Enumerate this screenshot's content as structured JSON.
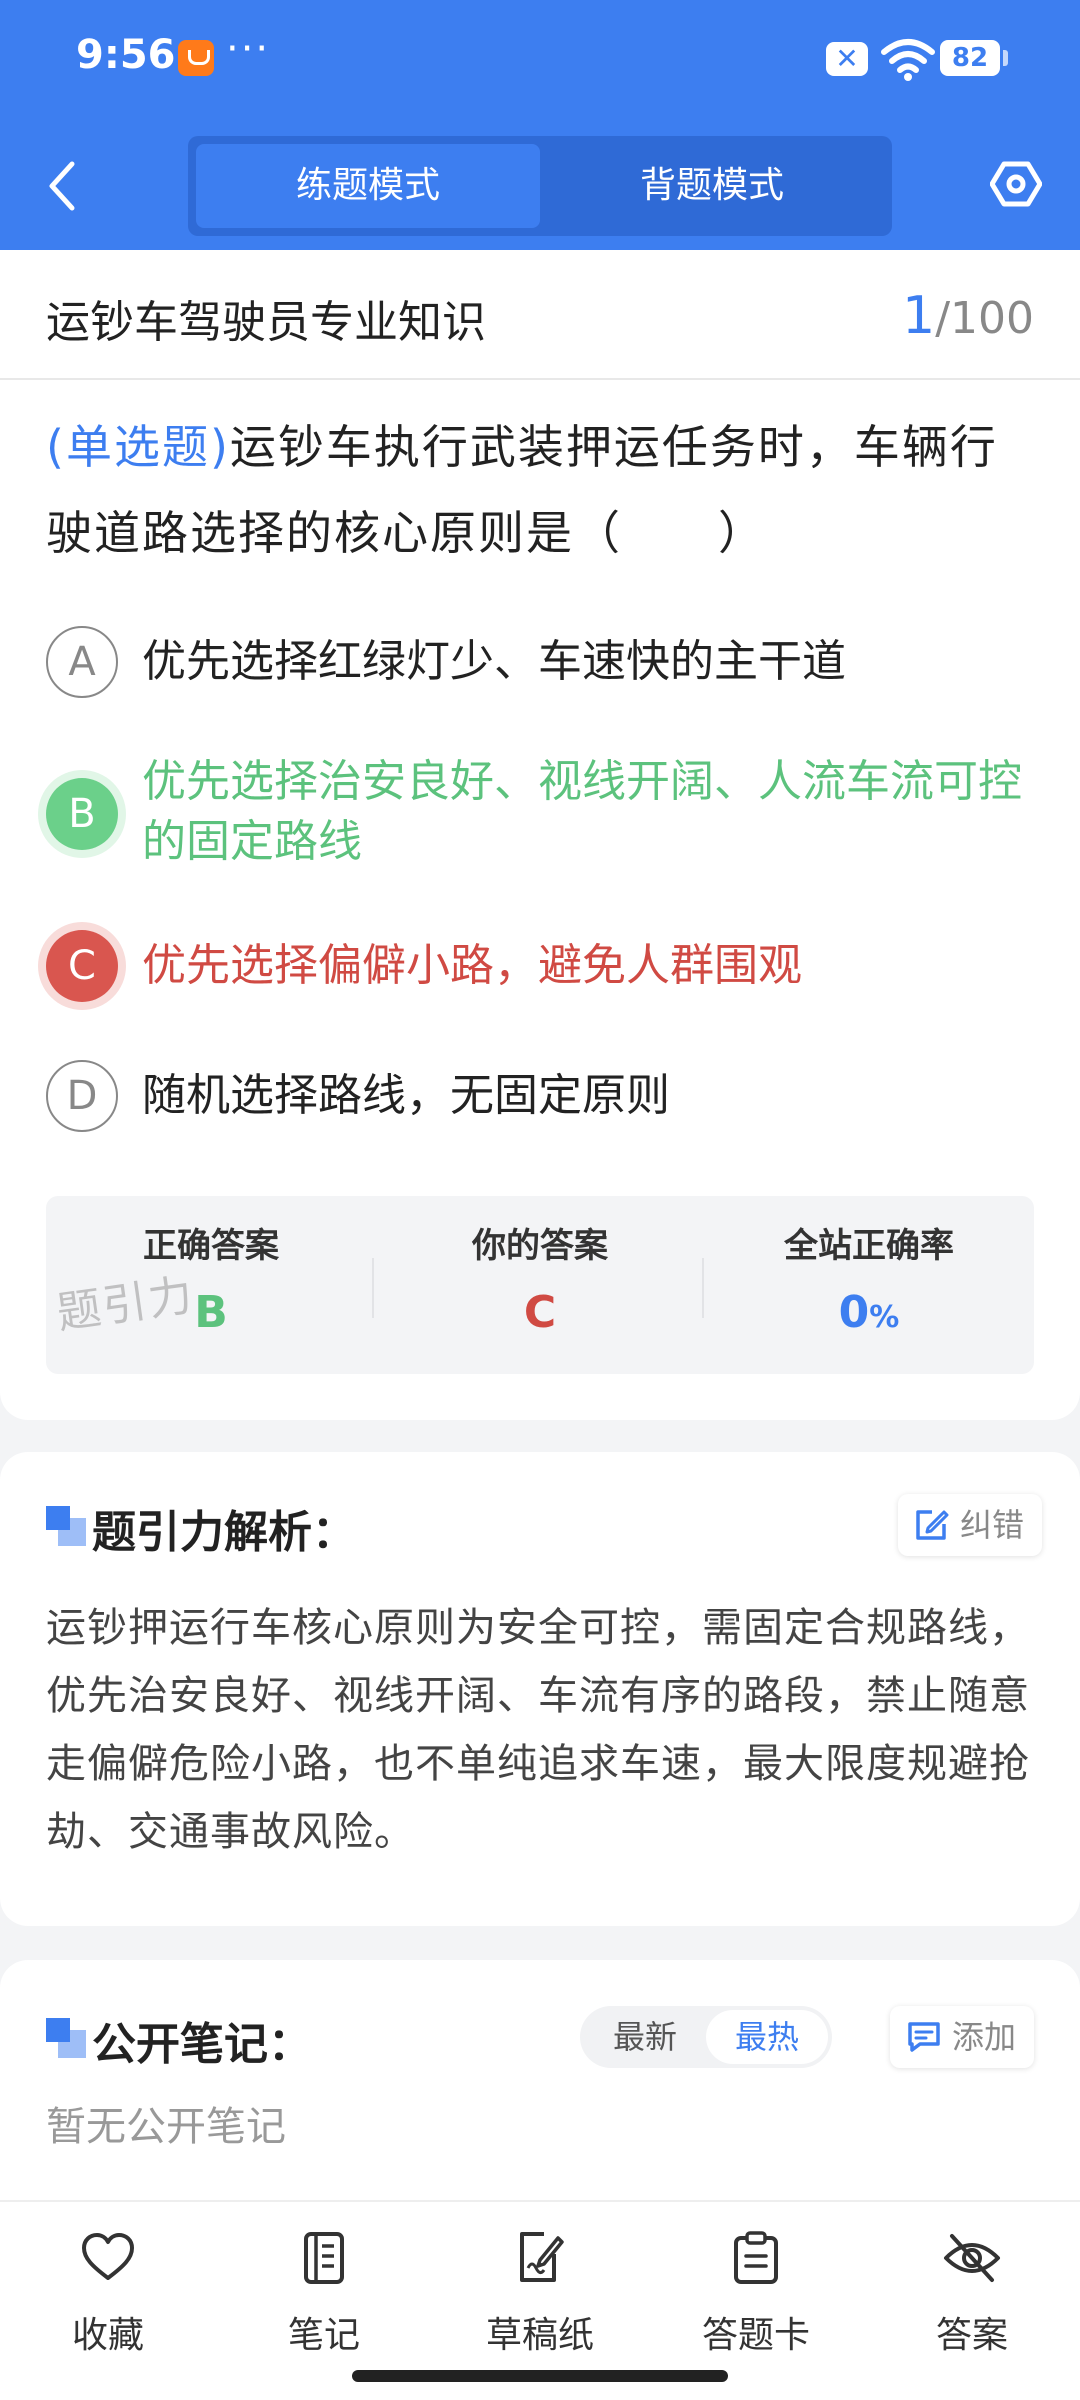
{
  "status_bar": {
    "time": "9:56",
    "dots": "···",
    "battery": "82",
    "x_badge": "✕"
  },
  "header": {
    "tabs": [
      {
        "label": "练题模式",
        "active": true
      },
      {
        "label": "背题模式",
        "active": false
      }
    ]
  },
  "question_card": {
    "subject": "运钞车驾驶员专业知识",
    "counter": {
      "current": "1",
      "total": "/100"
    },
    "type_label": "(单选题)",
    "question_text": "运钞车执行武装押运任务时，车辆行驶道路选择的核心原则是（　　）",
    "options": [
      {
        "letter": "A",
        "text": "优先选择红绿灯少、车速快的主干道",
        "state": "normal"
      },
      {
        "letter": "B",
        "text": "优先选择治安良好、视线开阔、人流车流可控的固定路线",
        "state": "correct"
      },
      {
        "letter": "C",
        "text": "优先选择偏僻小路，避免人群围观",
        "state": "wrong"
      },
      {
        "letter": "D",
        "text": "随机选择路线，无固定原则",
        "state": "normal"
      }
    ],
    "stats": {
      "correct_label": "正确答案",
      "correct_value": "B",
      "yours_label": "你的答案",
      "yours_value": "C",
      "rate_label": "全站正确率",
      "rate_value": "0",
      "rate_unit": "%"
    },
    "watermark": "题引力"
  },
  "analysis": {
    "title": "题引力解析：",
    "report_button": "纠错",
    "text": "运钞押运行车核心原则为安全可控，需固定合规路线，优先治安良好、视线开阔、车流有序的路段，禁止随意走偏僻危险小路，也不单纯追求车速，最大限度规避抢劫、交通事故风险。"
  },
  "notes": {
    "title": "公开笔记：",
    "sort": [
      {
        "label": "最新",
        "active": false
      },
      {
        "label": "最热",
        "active": true
      }
    ],
    "add_button": "添加",
    "empty_text": "暂无公开笔记"
  },
  "tabbar": [
    {
      "label": "收藏",
      "icon": "heart-icon"
    },
    {
      "label": "笔记",
      "icon": "notebook-icon"
    },
    {
      "label": "草稿纸",
      "icon": "draft-icon"
    },
    {
      "label": "答题卡",
      "icon": "clipboard-icon"
    },
    {
      "label": "答案",
      "icon": "eye-off-icon"
    }
  ],
  "colors": {
    "primary": "#3d7ef0",
    "correct": "#5cc27d",
    "wrong": "#d04a43"
  }
}
